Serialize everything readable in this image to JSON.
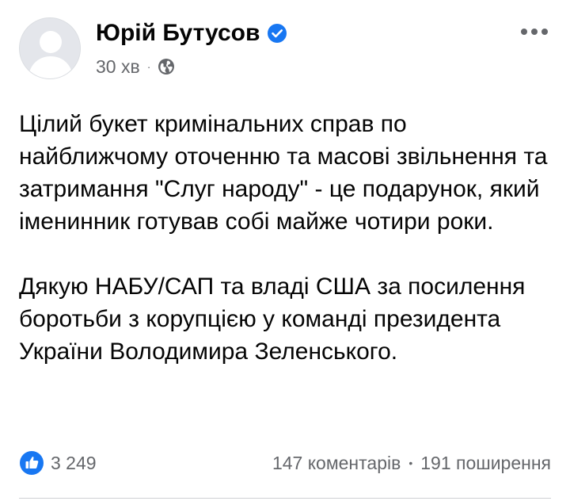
{
  "post": {
    "author": "Юрій Бутусов",
    "verified": true,
    "time": "30 хв",
    "separator": "·",
    "privacy_icon": "globe-icon",
    "paragraphs": [
      "Цілий букет кримінальних справ по найближчому оточенню та масові звільнення та затримання \"Слуг народу\"  - це подарунок, який іменинник готував собі майже чотири роки.",
      "Дякую НАБУ/САП та владі США за посилення боротьби з корупцією у команді президента України Володимира Зеленського."
    ]
  },
  "footer": {
    "like_count": "3 249",
    "comments": "147 коментарів",
    "stats_separator": "•",
    "shares": "191 поширення"
  },
  "colors": {
    "accent": "#1877f2",
    "secondary_text": "#65676b",
    "primary_text": "#050505"
  },
  "icons": [
    "avatar-placeholder",
    "verified-badge-icon",
    "globe-icon",
    "more-options-icon",
    "like-icon"
  ]
}
